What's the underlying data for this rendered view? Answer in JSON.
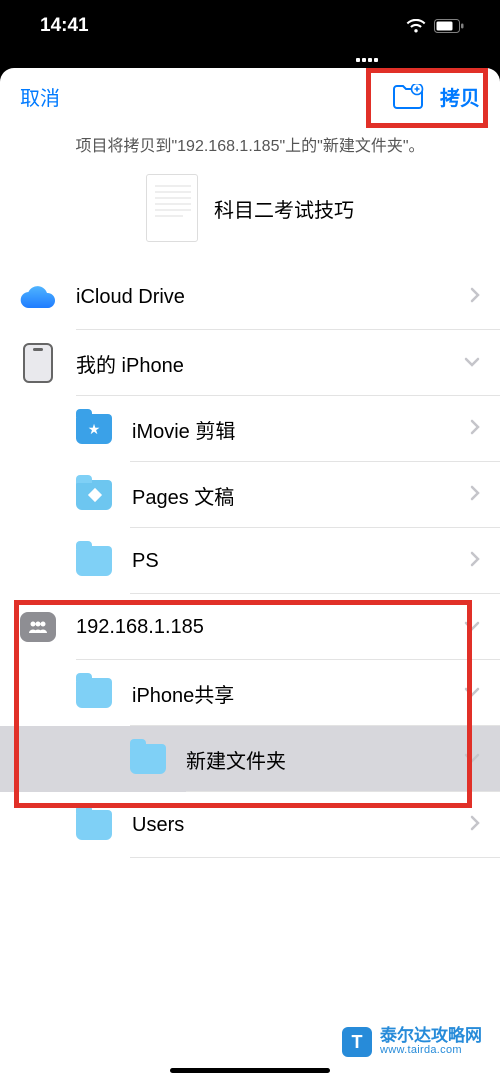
{
  "status": {
    "time": "14:41"
  },
  "header": {
    "cancel": "取消",
    "copy": "拷贝"
  },
  "subtitle": "项目将拷贝到\"192.168.1.185\"上的\"新建文件夹\"。",
  "preview": {
    "filename": "科目二考试技巧"
  },
  "list": {
    "icloud": "iCloud Drive",
    "myiphone": "我的 iPhone",
    "imovie": "iMovie 剪辑",
    "pages": "Pages 文稿",
    "ps": "PS",
    "server": "192.168.1.185",
    "iphoneshare": "iPhone共享",
    "newfolder": "新建文件夹",
    "users": "Users"
  },
  "watermark": {
    "logo": "T",
    "cn": "泰尔达攻略网",
    "en": "www.tairda.com"
  }
}
